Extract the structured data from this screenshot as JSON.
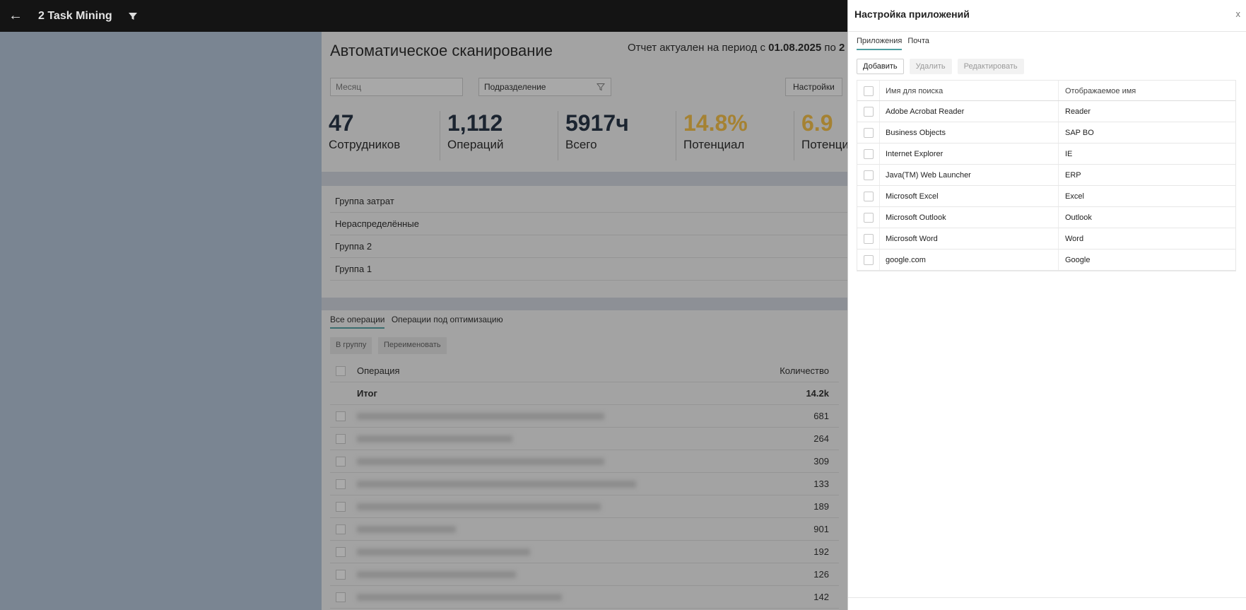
{
  "topbar": {
    "title": "2 Task Mining",
    "back_icon": "arrow-left-icon",
    "filter_icon": "filter-icon"
  },
  "background": {
    "heading": "Автоматическое сканирование",
    "period_prefix": "Отчет актуален на период с ",
    "period_from": "01.08.2025",
    "period_to_prefix": " по ",
    "period_to": "2",
    "month_placeholder": "Месяц",
    "department_label": "Подразделение",
    "settings_button": "Настройки",
    "kpis": [
      {
        "value": "47",
        "label": "Сотрудников"
      },
      {
        "value": "1,112",
        "label": "Операций"
      },
      {
        "value": "5917ч",
        "label": "Всего"
      },
      {
        "value": "14.8%",
        "label": "Потенциал"
      },
      {
        "value": "6.9",
        "label": "Потенци"
      }
    ],
    "groups_header": "Группа затрат",
    "groups": [
      "Нераспределённые",
      "Группа 2",
      "Группа 1"
    ],
    "tabs": [
      "Все операции",
      "Операции под оптимизацию"
    ],
    "btn_group": "В группу",
    "btn_rename": "Переименовать",
    "col_operation": "Операция",
    "col_quantity": "Количество",
    "total_label": "Итог",
    "total_value": "14.2k",
    "quantities": [
      "681",
      "264",
      "309",
      "133",
      "189",
      "901",
      "192",
      "126",
      "142"
    ]
  },
  "panel": {
    "title": "Настройка приложений",
    "close": "x",
    "tabs": [
      "Приложения",
      "Почта"
    ],
    "buttons": {
      "add": "Добавить",
      "delete": "Удалить",
      "edit": "Редактировать"
    },
    "columns": {
      "search_name": "Имя для поиска",
      "display_name": "Отображаемое имя"
    },
    "rows": [
      {
        "search": "Adobe Acrobat Reader",
        "display": "Reader"
      },
      {
        "search": "Business Objects",
        "display": "SAP BO"
      },
      {
        "search": "Internet Explorer",
        "display": "IE"
      },
      {
        "search": "Java(TM) Web Launcher",
        "display": "ERP"
      },
      {
        "search": "Microsoft Excel",
        "display": "Excel"
      },
      {
        "search": "Microsoft Outlook",
        "display": "Outlook"
      },
      {
        "search": "Microsoft Word",
        "display": "Word"
      },
      {
        "search": "google.com",
        "display": "Google"
      }
    ]
  }
}
